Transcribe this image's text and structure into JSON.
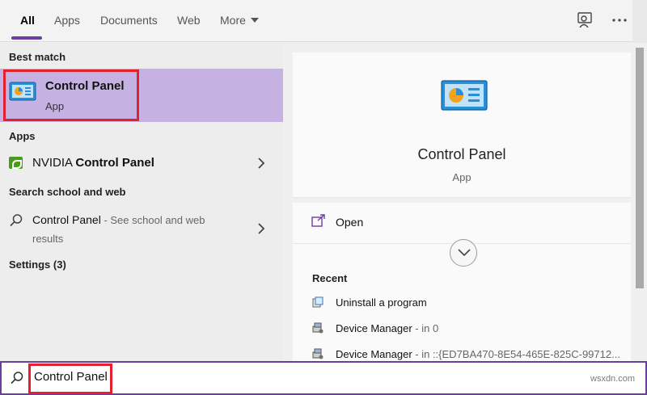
{
  "tabs": [
    {
      "label": "All",
      "active": true
    },
    {
      "label": "Apps"
    },
    {
      "label": "Documents"
    },
    {
      "label": "Web"
    },
    {
      "label": "More"
    }
  ],
  "top_icons": [
    "feedback-icon",
    "more-options-icon"
  ],
  "left": {
    "best_match_heading": "Best match",
    "best_match": {
      "title": "Control Panel",
      "subtitle": "App",
      "icon": "control-panel-icon"
    },
    "apps_heading": "Apps",
    "apps": [
      {
        "label_prefix": "NVIDIA ",
        "label_bold": "Control Panel",
        "icon": "nvidia-icon"
      }
    ],
    "web_heading": "Search school and web",
    "web_result": {
      "query": "Control Panel",
      "suffix": " - See school and web",
      "suffix2": "results",
      "icon": "search-icon"
    },
    "settings_heading": "Settings (3)"
  },
  "preview": {
    "title": "Control Panel",
    "subtitle": "App",
    "open_label": "Open",
    "recent_heading": "Recent",
    "recent": [
      {
        "label": "Uninstall a program",
        "meta": ""
      },
      {
        "label": "Device Manager",
        "meta": " - in 0"
      },
      {
        "label": "Device Manager",
        "meta": " - in ::{ED7BA470-8E54-465E-825C-99712..."
      }
    ]
  },
  "search": {
    "value": "Control Panel",
    "placeholder": ""
  },
  "watermark": "wsxdn.com",
  "colors": {
    "accent": "#6b3fa0",
    "highlight": "#c5b2e2",
    "annotation": "#e3202e",
    "nvidia": "#4b9b1a"
  }
}
